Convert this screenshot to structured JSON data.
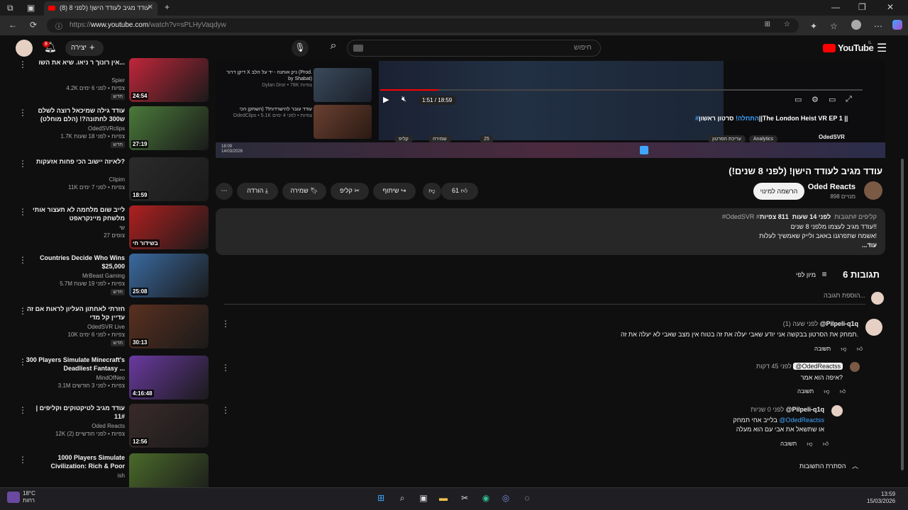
{
  "browser": {
    "tab_title": "עודד מגיב לעודד הישן! (לפני 8 (8)",
    "url_prefix": "https://",
    "url_domain": "www.youtube.com",
    "url_path": "/watch?v=sPLHyVaqdyw"
  },
  "header": {
    "logo_text": "YouTube",
    "logo_region": "IL",
    "search_placeholder": "חיפוש",
    "create_label": "יצירה",
    "notifications_count": "8"
  },
  "sidebar": {
    "items": [
      {
        "title": "אין רונוך ר ניאו. שיא את השו...",
        "channel": "Spier",
        "meta": "4.2K צפיות • לפני 6 ימים",
        "badge": "חדש",
        "duration": "24:54",
        "color": "#c0263a"
      },
      {
        "title": "עודד גילה שמיכאל רוצה לשלם ש300 לחתונה?! (הלם מוחלט)",
        "channel": "OdedSVRclips",
        "meta": "1.7K צפיות • לפני 18 שעות",
        "badge": "חדש",
        "duration": "27:19",
        "color": "#4a7a3a"
      },
      {
        "title": "לאיזה יישוב הכי פחות אזעקות?",
        "channel": "Clipim",
        "meta": "11K צפיות • לפני 7 ימים",
        "badge": "",
        "duration": "18:59",
        "color": "#2b2b2b"
      },
      {
        "title": "לייב שום מלחמה לא תעצור אותי מלשחק מיינקראפט",
        "channel": "שי",
        "meta": "27 צופים",
        "badge": "",
        "duration": "בשידור חי",
        "color": "#b02020"
      },
      {
        "title": "Countries Decide Who Wins $25,000",
        "channel": "MrBeast Gaming",
        "meta": "5.7M צפיות • לפני 19 שעות",
        "badge": "חדש",
        "duration": "25:08",
        "color": "#3a6aa0"
      },
      {
        "title": "חזרתי לאחתון העליון לראות אם זה עדיין קל מדי",
        "channel": "OdedSVR Live",
        "meta": "10K צפיות • לפני 6 ימים",
        "badge": "חדש",
        "duration": "30:13",
        "color": "#5a3020"
      },
      {
        "title": "300 Players Simulate Minecraft's Deadliest Fantasy ...",
        "channel": "MindOfNeo",
        "meta": "3.1M צפיות • לפני 3 חודשים",
        "badge": "",
        "duration": "4:16:48",
        "color": "#6a3aa0"
      },
      {
        "title": "עודד מגיב לטיקטוקים וקליפים | 11#",
        "channel": "Oded Reacts",
        "meta": "12K צפיות • לפני חודשיים (2)",
        "badge": "",
        "duration": "12:56",
        "color": "#3a2a2a"
      },
      {
        "title": "1000 Players Simulate Civilization: Rich & Poor",
        "channel": "ish",
        "meta": "",
        "badge": "",
        "duration": "",
        "color": "#4a6a2a"
      }
    ]
  },
  "player": {
    "time": "1:51 / 18:59",
    "title_tag": "#התחלה!",
    "title_text": "סרטון ראשון||The London Heist VR EP 1 ||",
    "channel": "OdedSVR",
    "mini_items": [
      {
        "title": "דיקן דרור X ניק אוחנה - יד על הלב (Prod. by Shabat)",
        "sub": "Dylan Dror • 78K צפיות"
      },
      {
        "title": "עודד עובר להישרדות!? (השחקן הכי",
        "sub": "OdedClips • 5.1K צפיות • לפני 4 ימים"
      }
    ],
    "chips": [
      "Analytics",
      "עריכת הסרטון",
      "קליפ",
      "שמירה",
      "25"
    ],
    "inner_clock": "18:09 14/03/2026"
  },
  "video": {
    "title": "עודד מגיב לעודד הישן! (לפני 8 שנים!)",
    "channel_name": "Oded Reacts",
    "subscribers": "898 מנויים",
    "subscribe_label": "הרשמה למינוי",
    "likes": "61",
    "share_label": "שיתוף",
    "clip_label": "קליפ",
    "save_label": "שמירה",
    "download_label": "הורדה"
  },
  "description": {
    "views": "811 צפיות",
    "time": "לפני 14 שעות",
    "tags": "#OdedSVR #קליפים #תגובות",
    "line1": "עודד מגיב לעצמו מלפני 8 שנים!!",
    "line2": "אשמח שתפרגנו באאב ולייק שאמשיך לעלות!",
    "more": "...עוד"
  },
  "comments": {
    "count_label": "6 תגובות",
    "sort_label": "מיון לפי",
    "add_placeholder": "הוספת תגובה...",
    "reply_label": "תשובה",
    "hide_replies": "הסתרת התשובות",
    "items": [
      {
        "author": "@Pilpeli-q1q",
        "time": "לפני שעה (1)",
        "text": "תמחק את הסרטון בבקשה אני יודע שאבי יעלה את זה בטוח אין מצב שאבי לא יעלה את זה."
      },
      {
        "author": "@OdedReactss",
        "time": "לפני 45 דקות",
        "text": "איפה הוא אמר?"
      },
      {
        "author": "@Pilpeli-q1q",
        "time": "לפני 0 שניות",
        "mention": "@OdedReactss",
        "text": "בלייב אחי תמחק",
        "text2": "או שתשאל את אבי עם הוא מעלה"
      }
    ]
  },
  "taskbar": {
    "temp": "18°C",
    "weather": "רחות",
    "time": "13:59",
    "date": "15/03/2026"
  }
}
